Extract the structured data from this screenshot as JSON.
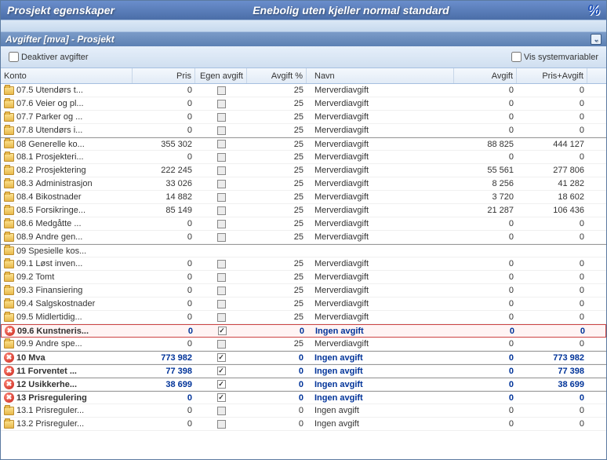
{
  "header": {
    "title_left": "Prosjekt egenskaper",
    "title_right": "Enebolig uten kjeller normal standard"
  },
  "subheader": {
    "title": "Avgifter [mva] - Prosjekt"
  },
  "controls": {
    "deactivate_label": "Deaktiver avgifter",
    "sysvars_label": "Vis systemvariabler"
  },
  "columns": {
    "konto": "Konto",
    "pris": "Pris",
    "egen": "Egen avgift",
    "avgpct": "Avgift %",
    "navn": "Navn",
    "avgift": "Avgift",
    "prisavg": "Pris+Avgift"
  },
  "rows": [
    {
      "icon": "folder",
      "code": "07.5",
      "name": "Utendørs t...",
      "pris": "0",
      "egen": false,
      "egen_on": false,
      "avgpct": "25",
      "navn": "Merverdiavgift",
      "avgift": "0",
      "prisavg": "0"
    },
    {
      "icon": "folder",
      "code": "07.6",
      "name": "Veier og pl...",
      "pris": "0",
      "egen": false,
      "egen_on": false,
      "avgpct": "25",
      "navn": "Merverdiavgift",
      "avgift": "0",
      "prisavg": "0"
    },
    {
      "icon": "folder",
      "code": "07.7",
      "name": "Parker og ...",
      "pris": "0",
      "egen": false,
      "egen_on": false,
      "avgpct": "25",
      "navn": "Merverdiavgift",
      "avgift": "0",
      "prisavg": "0"
    },
    {
      "icon": "folder",
      "code": "07.8",
      "name": "Utendørs i...",
      "pris": "0",
      "egen": false,
      "egen_on": false,
      "avgpct": "25",
      "navn": "Merverdiavgift",
      "avgift": "0",
      "prisavg": "0"
    },
    {
      "icon": "folder",
      "code": "08",
      "name": "Generelle ko...",
      "pris": "355 302",
      "egen": false,
      "egen_on": false,
      "avgpct": "25",
      "navn": "Merverdiavgift",
      "avgift": "88 825",
      "prisavg": "444 127",
      "top": true
    },
    {
      "icon": "folder",
      "code": "08.1",
      "name": "Prosjekteri...",
      "pris": "0",
      "egen": false,
      "egen_on": false,
      "avgpct": "25",
      "navn": "Merverdiavgift",
      "avgift": "0",
      "prisavg": "0"
    },
    {
      "icon": "folder",
      "code": "08.2",
      "name": "Prosjektering",
      "pris": "222 245",
      "egen": false,
      "egen_on": false,
      "avgpct": "25",
      "navn": "Merverdiavgift",
      "avgift": "55 561",
      "prisavg": "277 806"
    },
    {
      "icon": "folder",
      "code": "08.3",
      "name": "Administrasjon",
      "pris": "33 026",
      "egen": false,
      "egen_on": false,
      "avgpct": "25",
      "navn": "Merverdiavgift",
      "avgift": "8 256",
      "prisavg": "41 282"
    },
    {
      "icon": "folder",
      "code": "08.4",
      "name": "Bikostnader",
      "pris": "14 882",
      "egen": false,
      "egen_on": false,
      "avgpct": "25",
      "navn": "Merverdiavgift",
      "avgift": "3 720",
      "prisavg": "18 602"
    },
    {
      "icon": "folder",
      "code": "08.5",
      "name": "Forsikringe...",
      "pris": "85 149",
      "egen": false,
      "egen_on": false,
      "avgpct": "25",
      "navn": "Merverdiavgift",
      "avgift": "21 287",
      "prisavg": "106 436"
    },
    {
      "icon": "folder",
      "code": "08.6",
      "name": "Medgåtte ...",
      "pris": "0",
      "egen": false,
      "egen_on": false,
      "avgpct": "25",
      "navn": "Merverdiavgift",
      "avgift": "0",
      "prisavg": "0"
    },
    {
      "icon": "folder",
      "code": "08.9",
      "name": "Andre gen...",
      "pris": "0",
      "egen": false,
      "egen_on": false,
      "avgpct": "25",
      "navn": "Merverdiavgift",
      "avgift": "0",
      "prisavg": "0"
    },
    {
      "icon": "folder",
      "code": "09",
      "name": "Spesielle kos...",
      "pris": "",
      "egen": null,
      "egen_on": false,
      "avgpct": "",
      "navn": "",
      "avgift": "",
      "prisavg": "",
      "top": true
    },
    {
      "icon": "folder",
      "code": "09.1",
      "name": "Løst inven...",
      "pris": "0",
      "egen": false,
      "egen_on": false,
      "avgpct": "25",
      "navn": "Merverdiavgift",
      "avgift": "0",
      "prisavg": "0"
    },
    {
      "icon": "folder",
      "code": "09.2",
      "name": "Tomt",
      "pris": "0",
      "egen": false,
      "egen_on": false,
      "avgpct": "25",
      "navn": "Merverdiavgift",
      "avgift": "0",
      "prisavg": "0"
    },
    {
      "icon": "folder",
      "code": "09.3",
      "name": "Finansiering",
      "pris": "0",
      "egen": false,
      "egen_on": false,
      "avgpct": "25",
      "navn": "Merverdiavgift",
      "avgift": "0",
      "prisavg": "0"
    },
    {
      "icon": "folder",
      "code": "09.4",
      "name": "Salgskostnader",
      "pris": "0",
      "egen": false,
      "egen_on": false,
      "avgpct": "25",
      "navn": "Merverdiavgift",
      "avgift": "0",
      "prisavg": "0"
    },
    {
      "icon": "folder",
      "code": "09.5",
      "name": "Midlertidig...",
      "pris": "0",
      "egen": false,
      "egen_on": false,
      "avgpct": "25",
      "navn": "Merverdiavgift",
      "avgift": "0",
      "prisavg": "0"
    },
    {
      "icon": "red",
      "code": "09.6",
      "name": "Kunstneris...",
      "pris": "0",
      "egen": true,
      "egen_on": true,
      "avgpct": "0",
      "navn": "Ingen avgift",
      "avgift": "0",
      "prisavg": "0",
      "bold": true,
      "blue": true,
      "highlight": true
    },
    {
      "icon": "folder",
      "code": "09.9",
      "name": "Andre spe...",
      "pris": "0",
      "egen": false,
      "egen_on": false,
      "avgpct": "25",
      "navn": "Merverdiavgift",
      "avgift": "0",
      "prisavg": "0"
    },
    {
      "icon": "red",
      "code": "10",
      "name": "Mva",
      "pris": "773 982",
      "egen": true,
      "egen_on": true,
      "avgpct": "0",
      "navn": "Ingen avgift",
      "avgift": "0",
      "prisavg": "773 982",
      "bold": true,
      "blue": true,
      "top": true
    },
    {
      "icon": "red",
      "code": "11",
      "name": "Forventet ...",
      "pris": "77 398",
      "egen": true,
      "egen_on": true,
      "avgpct": "0",
      "navn": "Ingen avgift",
      "avgift": "0",
      "prisavg": "77 398",
      "bold": true,
      "blue": true,
      "top": true
    },
    {
      "icon": "red",
      "code": "12",
      "name": "Usikkerhe...",
      "pris": "38 699",
      "egen": true,
      "egen_on": true,
      "avgpct": "0",
      "navn": "Ingen avgift",
      "avgift": "0",
      "prisavg": "38 699",
      "bold": true,
      "blue": true,
      "top": true
    },
    {
      "icon": "red",
      "code": "13",
      "name": "Prisregulering",
      "pris": "0",
      "egen": true,
      "egen_on": true,
      "avgpct": "0",
      "navn": "Ingen avgift",
      "avgift": "0",
      "prisavg": "0",
      "bold": true,
      "blue": true,
      "top": true
    },
    {
      "icon": "folder",
      "code": "13.1",
      "name": "Prisreguler...",
      "pris": "0",
      "egen": false,
      "egen_on": false,
      "avgpct": "0",
      "navn": "Ingen avgift",
      "avgift": "0",
      "prisavg": "0"
    },
    {
      "icon": "folder",
      "code": "13.2",
      "name": "Prisreguler...",
      "pris": "0",
      "egen": false,
      "egen_on": false,
      "avgpct": "0",
      "navn": "Ingen avgift",
      "avgift": "0",
      "prisavg": "0"
    }
  ]
}
